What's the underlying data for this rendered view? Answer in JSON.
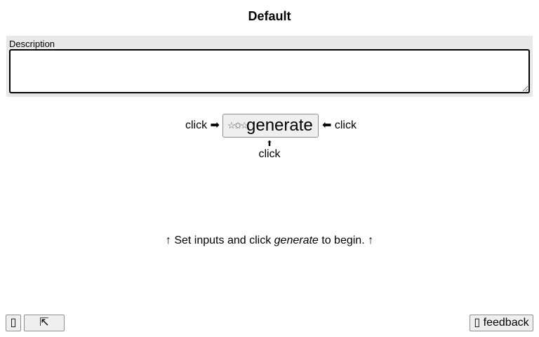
{
  "header": {
    "title": "Default"
  },
  "description": {
    "label": "Description",
    "value": "",
    "placeholder": ""
  },
  "generate_area": {
    "click_left": "click ➡",
    "button_icon": "☆✩☆",
    "button_label": "generate",
    "click_right": "⬅ click",
    "up_arrow": "⬆",
    "click_below": "click"
  },
  "hint": {
    "prefix": "↑ Set inputs and click ",
    "emphasis": "generate",
    "suffix": " to begin. ↑"
  },
  "footer": {
    "menu_icon": "▯",
    "fullscreen_icon": "⇱",
    "feedback_label": "▯ feedback"
  }
}
